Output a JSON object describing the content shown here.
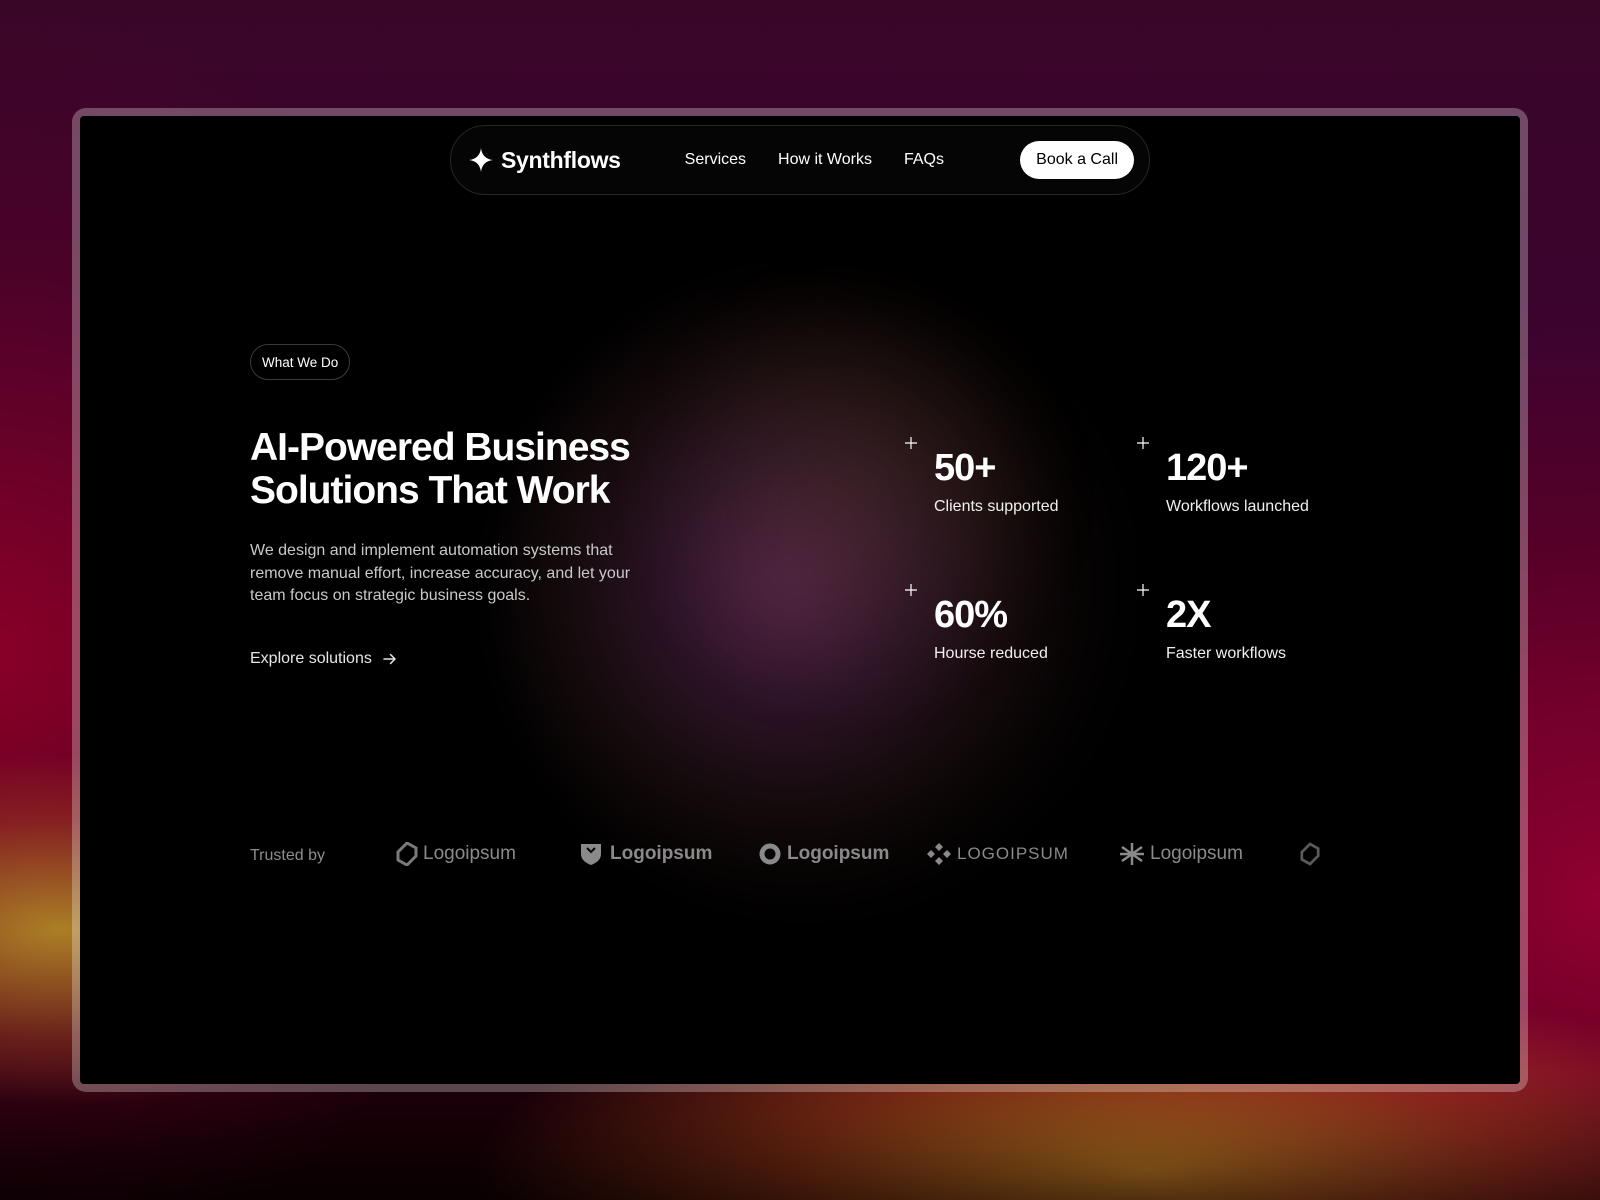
{
  "brand": {
    "name": "Synthflows",
    "icon": "sparkle-icon"
  },
  "nav": {
    "links": [
      "Services",
      "How it Works",
      "FAQs"
    ],
    "cta": "Book a Call"
  },
  "hero": {
    "tag": "What We Do",
    "title": "AI-Powered Business Solutions That Work",
    "description": "We design and implement automation systems that remove manual effort, increase accuracy, and let your team focus on strategic business goals.",
    "link": "Explore solutions",
    "link_icon": "arrow-right-icon"
  },
  "stats": [
    {
      "value": "50+",
      "label": "Clients supported"
    },
    {
      "value": "120+",
      "label": "Workflows launched"
    },
    {
      "value": "60%",
      "label": "Hourse reduced"
    },
    {
      "value": "2X",
      "label": "Faster workflows"
    }
  ],
  "trusted": {
    "label": "Trusted by",
    "logos": [
      "Logoipsum",
      "Logoipsum",
      "Logoipsum",
      "LOGOIPSUM",
      "Logoipsum"
    ]
  },
  "colors": {
    "background": "#000000",
    "accent_glow": "#6e2d5f",
    "cta_bg": "#ffffff"
  }
}
